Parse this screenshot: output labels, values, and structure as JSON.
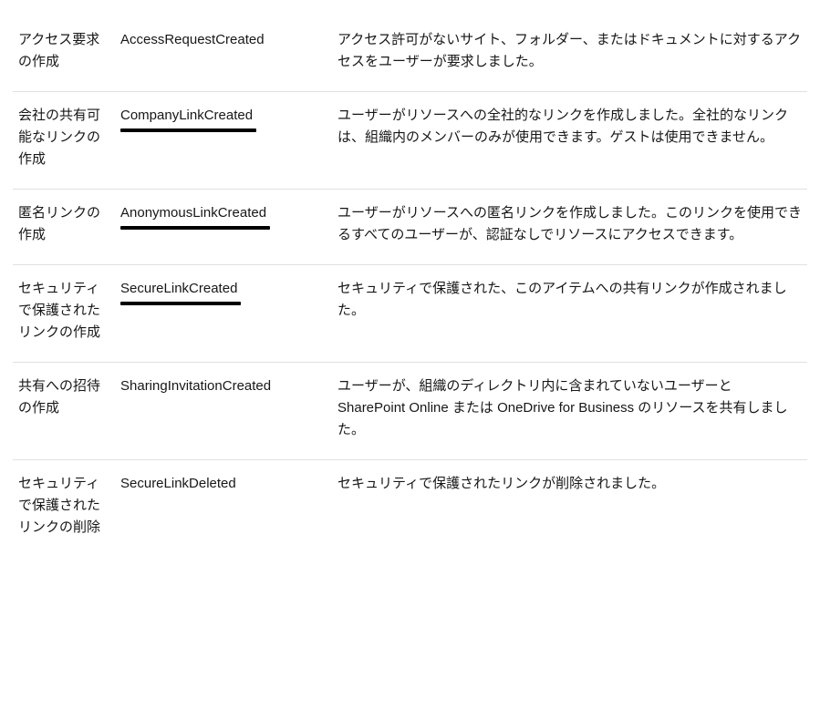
{
  "rows": [
    {
      "name_jp": "アクセス要求の作成",
      "operation": "AccessRequestCreated",
      "underline": false,
      "description": "アクセス許可がないサイト、フォルダー、またはドキュメントに対するアクセスをユーザーが要求しました。"
    },
    {
      "name_jp": "会社の共有可能なリンクの作成",
      "operation": "CompanyLinkCreated",
      "underline": true,
      "description": "ユーザーがリソースへの全社的なリンクを作成しました。全社的なリンクは、組織内のメンバーのみが使用できます。ゲストは使用できません。"
    },
    {
      "name_jp": "匿名リンクの作成",
      "operation": "AnonymousLinkCreated",
      "underline": true,
      "description": "ユーザーがリソースへの匿名リンクを作成しました。このリンクを使用できるすべてのユーザーが、認証なしでリソースにアクセスできます。"
    },
    {
      "name_jp": "セキュリティで保護されたリンクの作成",
      "operation": "SecureLinkCreated",
      "underline": true,
      "description": "セキュリティで保護された、このアイテムへの共有リンクが作成されました。"
    },
    {
      "name_jp": "共有への招待の作成",
      "operation": "SharingInvitationCreated",
      "underline": false,
      "description": "ユーザーが、組織のディレクトリ内に含まれていないユーザーと SharePoint Online または OneDrive for Business のリソースを共有しました。"
    },
    {
      "name_jp": "セキュリティで保護されたリンクの削除",
      "operation": "SecureLinkDeleted",
      "underline": false,
      "description": "セキュリティで保護されたリンクが削除されました。"
    }
  ]
}
